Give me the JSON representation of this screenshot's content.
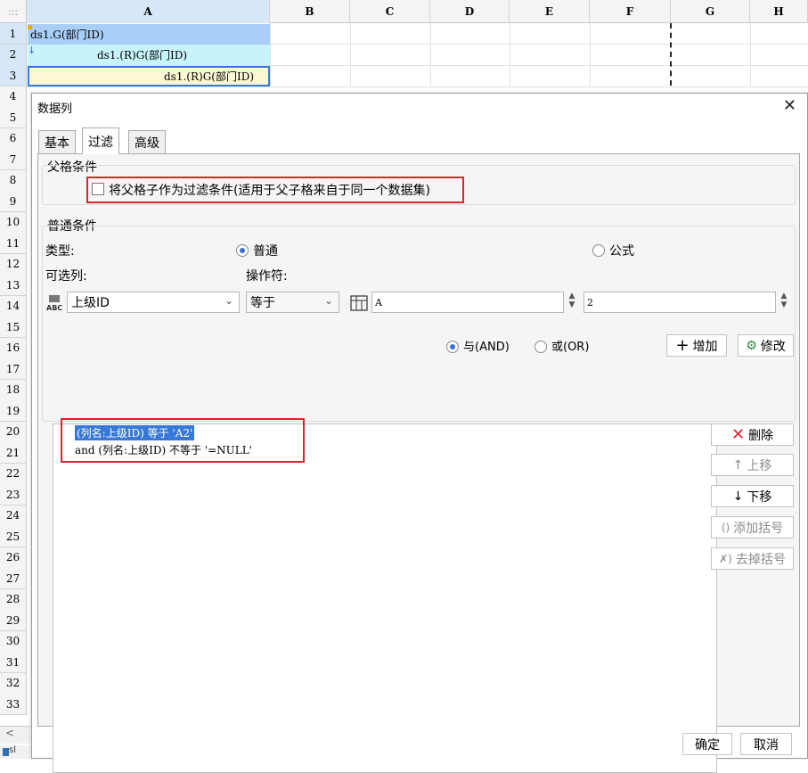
{
  "sheet": {
    "corner": ":::",
    "columns": [
      "A",
      "B",
      "C",
      "D",
      "E",
      "F",
      "G",
      "H"
    ],
    "rows": [
      "1",
      "2",
      "3",
      "4",
      "5",
      "6",
      "7",
      "8",
      "9",
      "10",
      "11",
      "12",
      "13",
      "14",
      "15",
      "16",
      "17",
      "18",
      "19",
      "20",
      "21",
      "22",
      "23",
      "24",
      "25",
      "26",
      "27",
      "28",
      "29",
      "30",
      "31",
      "32",
      "33"
    ],
    "cells": {
      "a1": "ds1.G(部门ID)",
      "a2": "ds1.(R)G(部门ID)",
      "a3": "ds1.(R)G(部门ID)"
    },
    "scroll_left": "<",
    "sheet_tab": "sl"
  },
  "dialog": {
    "title": "数据列",
    "close": "✕",
    "tabs": [
      "基本",
      "过滤",
      "高级"
    ],
    "active_tab": "过滤",
    "parent_group": {
      "title": "父格条件",
      "checkbox_label": "将父格子作为过滤条件(适用于父子格来自于同一个数据集)",
      "checked": false
    },
    "common_group": {
      "title": "普通条件",
      "type_label": "类型:",
      "radio_normal": "普通",
      "radio_formula": "公式",
      "selected_type": "普通",
      "column_label": "可选列:",
      "operator_label": "操作符:",
      "column_value": "上级ID",
      "operator_value": "等于",
      "value_field": "A",
      "number_field": "2",
      "radio_and": "与(AND)",
      "radio_or": "或(OR)",
      "selected_logic": "与(AND)",
      "add_button": "增加",
      "modify_button": "修改"
    },
    "conditions": [
      "(列名:上级ID) 等于 'A2'",
      "and (列名:上级ID) 不等于 '=NULL'"
    ],
    "side_buttons": {
      "delete": "删除",
      "move_up": "上移",
      "move_down": "下移",
      "add_bracket": "添加括号",
      "remove_bracket": "去掉括号"
    },
    "ok": "确定",
    "cancel": "取消"
  },
  "colors": {
    "selection_blue": "#3779d9",
    "header_selected": "#d7e7f8",
    "highlight_red": "#d9262d",
    "cell_a1_bg": "#a9cff7",
    "cell_a2_bg": "#c7f3fb",
    "cell_a3_bg": "#fff8d6"
  }
}
